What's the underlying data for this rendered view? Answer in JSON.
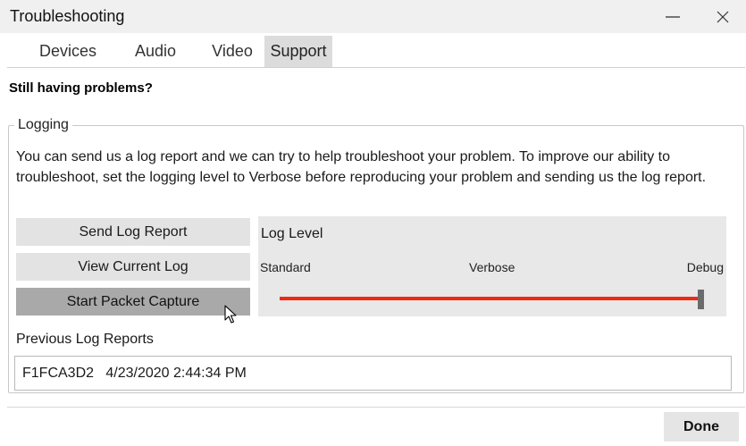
{
  "window": {
    "title": "Troubleshooting",
    "minimize_icon": "minimize-icon",
    "close_icon": "close-icon"
  },
  "tabs": [
    {
      "label": "Devices",
      "selected": false
    },
    {
      "label": "Audio",
      "selected": false
    },
    {
      "label": "Video",
      "selected": false
    },
    {
      "label": "Support",
      "selected": true
    }
  ],
  "heading": "Still having problems?",
  "logging": {
    "group_label": "Logging",
    "description": "You can send us a log report and we can try to help troubleshoot your problem. To improve our ability to troubleshoot, set the logging level to Verbose before reproducing your problem and sending us the log report.",
    "buttons": {
      "send": "Send Log Report",
      "view": "View Current Log",
      "capture": "Start Packet Capture"
    },
    "log_level": {
      "title": "Log Level",
      "labels": [
        "Standard",
        "Verbose",
        "Debug"
      ],
      "selected": "Debug",
      "value_fraction": 1.0
    },
    "previous_reports_label": "Previous Log Reports",
    "previous_reports": [
      {
        "id": "F1FCA3D2",
        "timestamp": "4/23/2020 2:44:34 PM"
      }
    ]
  },
  "footer": {
    "done_label": "Done"
  },
  "colors": {
    "slider_fill": "#ee2b12",
    "selected_tab": "#dcdcdc",
    "hovered_button": "#a9a9a9"
  }
}
